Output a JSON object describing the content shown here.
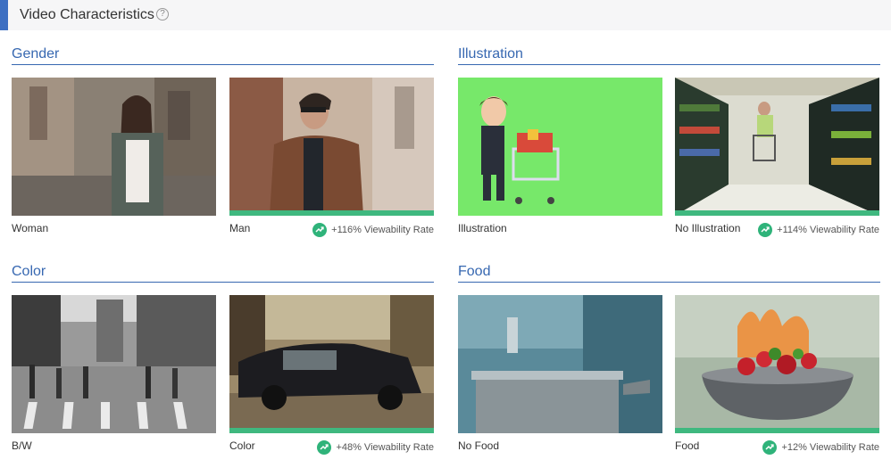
{
  "header": {
    "title": "Video Characteristics",
    "help": "?"
  },
  "colors": {
    "accent": "#3d6fc2",
    "section": "#3768b1",
    "winner": "#3fb87f",
    "trend": "#2fb37a"
  },
  "sections": [
    {
      "title": "Gender",
      "cards": [
        {
          "label": "Woman",
          "rate": ""
        },
        {
          "label": "Man",
          "rate": "+116% Viewability Rate"
        }
      ]
    },
    {
      "title": "Illustration",
      "cards": [
        {
          "label": "Illustration",
          "rate": ""
        },
        {
          "label": "No Illustration",
          "rate": "+114% Viewability Rate"
        }
      ]
    },
    {
      "title": "Color",
      "cards": [
        {
          "label": "B/W",
          "rate": ""
        },
        {
          "label": "Color",
          "rate": "+48% Viewability Rate"
        }
      ]
    },
    {
      "title": "Food",
      "cards": [
        {
          "label": "No Food",
          "rate": ""
        },
        {
          "label": "Food",
          "rate": "+12% Viewability Rate"
        }
      ]
    }
  ],
  "icons": {
    "help": "question-circle-icon",
    "trend": "trending-up-icon"
  }
}
